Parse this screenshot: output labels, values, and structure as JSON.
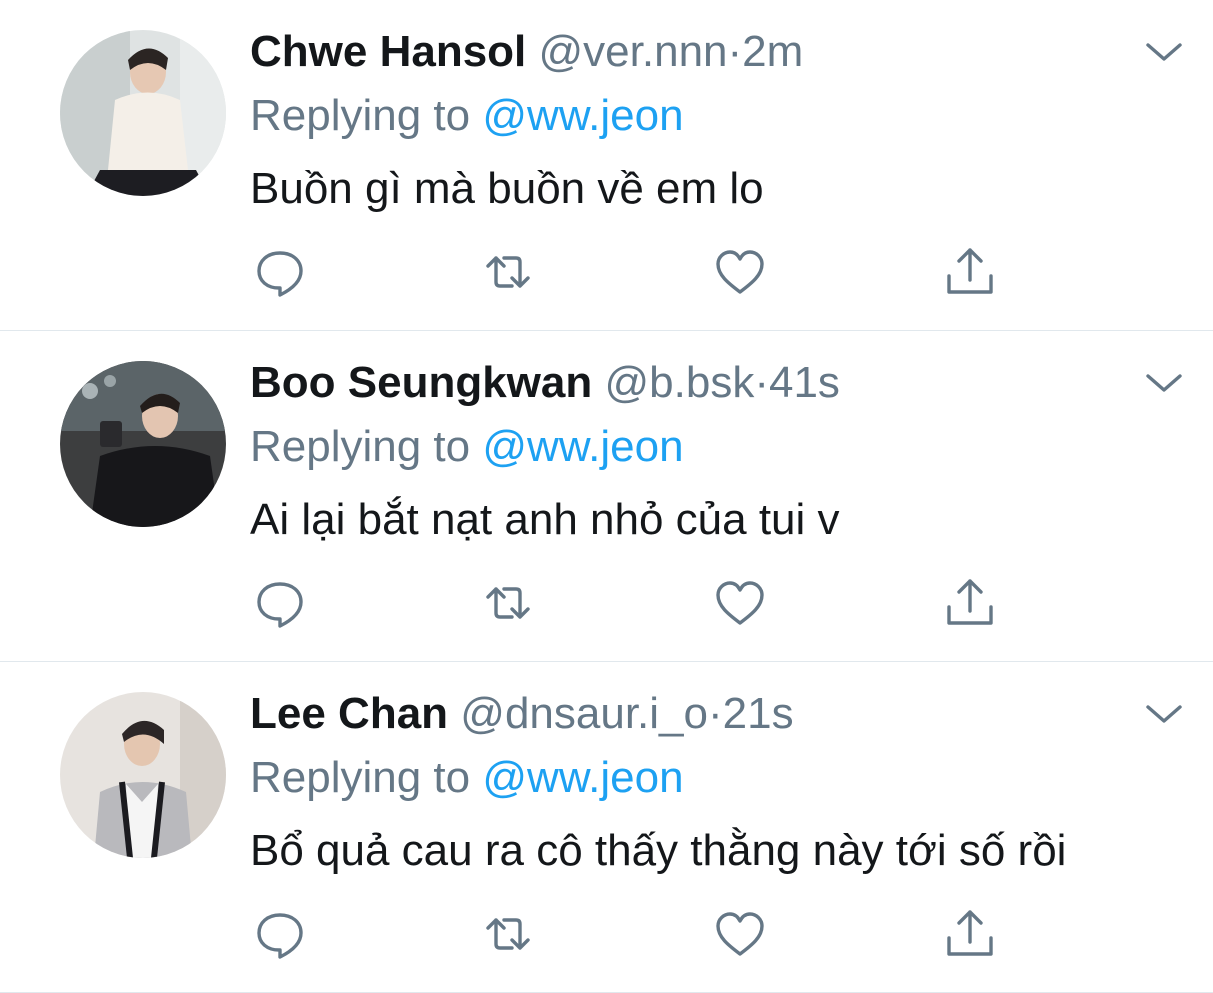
{
  "tweets": [
    {
      "name": "Chwe Hansol",
      "handle": "@ver.nnn",
      "sep": "·",
      "time": "2m",
      "reply_prefix": "Replying to",
      "reply_to": "@ww.jeon",
      "text": "Buồn gì mà buồn về em lo"
    },
    {
      "name": "Boo Seungkwan",
      "handle": "@b.bsk",
      "sep": "·",
      "time": "41s",
      "reply_prefix": "Replying to",
      "reply_to": "@ww.jeon",
      "text": "Ai lại bắt nạt anh nhỏ của tui v"
    },
    {
      "name": "Lee Chan",
      "handle": "@dnsaur.i_o",
      "sep": "·",
      "time": "21s",
      "reply_prefix": "Replying to",
      "reply_to": "@ww.jeon",
      "text": "Bổ quả cau ra cô thấy thằng này tới số rồi"
    }
  ],
  "icons": {
    "reply": "reply-icon",
    "retweet": "retweet-icon",
    "like": "heart-icon",
    "share": "share-icon",
    "menu": "chevron-down-icon"
  },
  "colors": {
    "name": "#14171a",
    "secondary": "#657786",
    "link": "#1da1f2",
    "divider": "#e1e8ed"
  }
}
